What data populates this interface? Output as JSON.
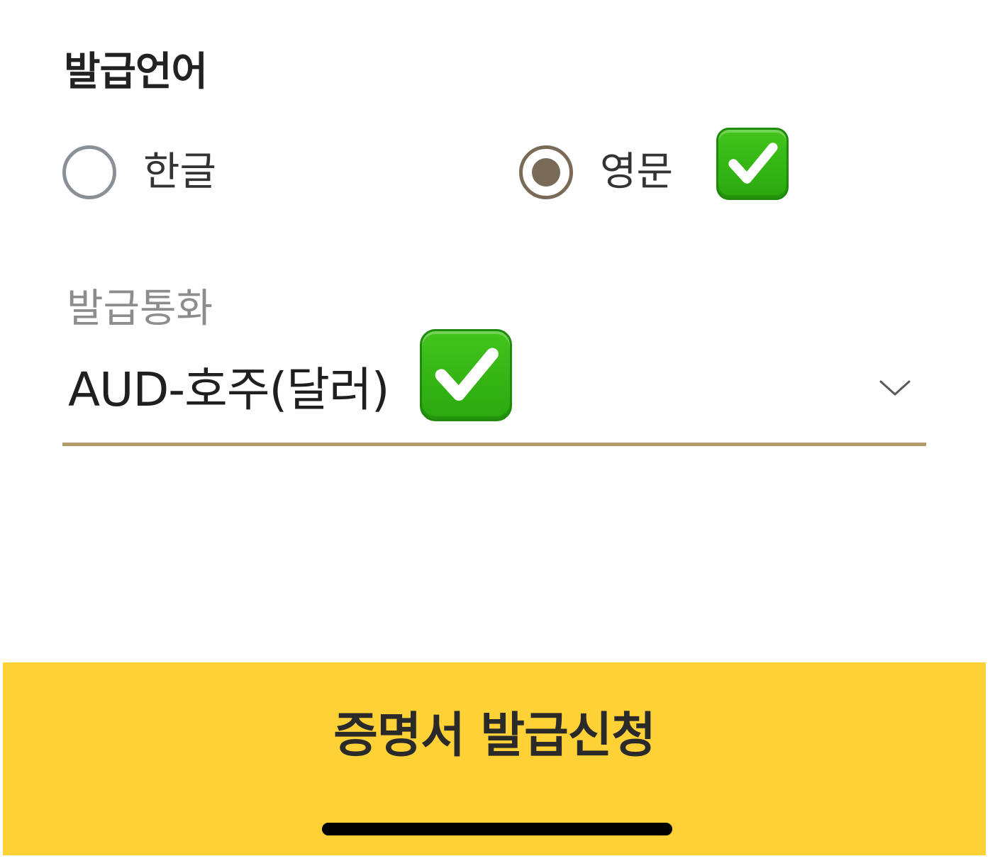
{
  "issue_language": {
    "title": "발급언어",
    "options": [
      {
        "label": "한글",
        "selected": false
      },
      {
        "label": "영문",
        "selected": true
      }
    ],
    "check_icon": "white-heavy-check-mark-icon"
  },
  "issue_currency": {
    "label": "발급통화",
    "value": "AUD-호주(달러)",
    "dropdown_icon": "chevron-down-icon",
    "check_icon": "white-heavy-check-mark-icon"
  },
  "cta": {
    "label": "증명서 발급신청"
  },
  "colors": {
    "cta_background": "#fed236",
    "radio_selected": "#7a6a58",
    "radio_unselected": "#8a9096",
    "underline_accent": "#b29a6a",
    "check_green": "#2aa80f"
  }
}
